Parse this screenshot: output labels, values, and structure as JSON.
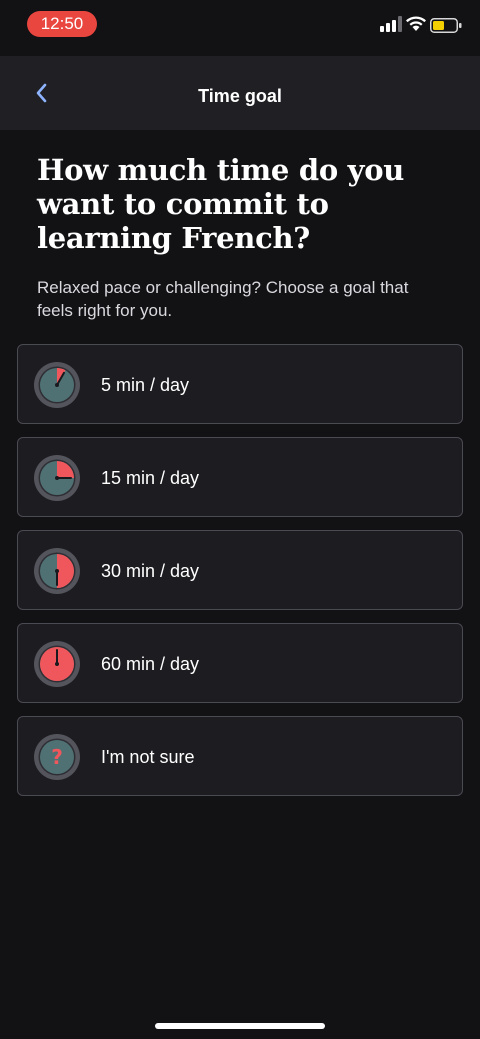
{
  "status_bar": {
    "time": "12:50",
    "icons": [
      "signal-icon",
      "wifi-icon",
      "battery-icon"
    ],
    "battery_color": "#f5d000",
    "time_pill_color": "#e9463f"
  },
  "nav": {
    "title": "Time goal",
    "back_icon": "chevron-left-icon",
    "accent_color": "#8fb4ff"
  },
  "question": {
    "heading": "How much time do you want to commit to learning French?",
    "subtitle": "Relaxed pace or challenging? Choose a goal that feels right for you."
  },
  "options": [
    {
      "label": "5 min / day",
      "icon": "timer-5-icon",
      "fraction": 0.083
    },
    {
      "label": "15 min / day",
      "icon": "timer-15-icon",
      "fraction": 0.25
    },
    {
      "label": "30 min / day",
      "icon": "timer-30-icon",
      "fraction": 0.5
    },
    {
      "label": "60 min / day",
      "icon": "timer-60-icon",
      "fraction": 1.0
    },
    {
      "label": "I'm not sure",
      "icon": "question-mark-icon",
      "fraction": null
    }
  ],
  "colors": {
    "clock_face": "#4f7173",
    "clock_ring": "#54545c",
    "clock_fill": "#f0575c",
    "background": "#121114",
    "card": "#1d1c21"
  }
}
